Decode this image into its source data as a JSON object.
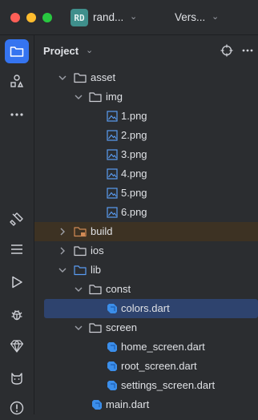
{
  "titlebar": {
    "project_badge": "RD",
    "project_name": "rand...",
    "vcs_label": "Vers..."
  },
  "panel": {
    "title": "Project"
  },
  "tree": [
    {
      "label": "asset",
      "type": "folder",
      "expanded": true
    },
    {
      "label": "img",
      "type": "folder",
      "expanded": true
    },
    {
      "label": "1.png",
      "type": "image"
    },
    {
      "label": "2.png",
      "type": "image"
    },
    {
      "label": "3.png",
      "type": "image"
    },
    {
      "label": "4.png",
      "type": "image"
    },
    {
      "label": "5.png",
      "type": "image"
    },
    {
      "label": "6.png",
      "type": "image"
    },
    {
      "label": "build",
      "type": "folder-excluded",
      "expanded": false
    },
    {
      "label": "ios",
      "type": "folder",
      "expanded": false
    },
    {
      "label": "lib",
      "type": "folder-source",
      "expanded": true
    },
    {
      "label": "const",
      "type": "folder",
      "expanded": true
    },
    {
      "label": "colors.dart",
      "type": "dart",
      "selected": true
    },
    {
      "label": "screen",
      "type": "folder",
      "expanded": true
    },
    {
      "label": "home_screen.dart",
      "type": "dart"
    },
    {
      "label": "root_screen.dart",
      "type": "dart"
    },
    {
      "label": "settings_screen.dart",
      "type": "dart"
    },
    {
      "label": "main.dart",
      "type": "dart"
    }
  ],
  "colors": {
    "accent": "#3574f0",
    "selected_row": "#2e436e",
    "excluded_row": "#3d3223",
    "dart_blue": "#3b8eea"
  }
}
